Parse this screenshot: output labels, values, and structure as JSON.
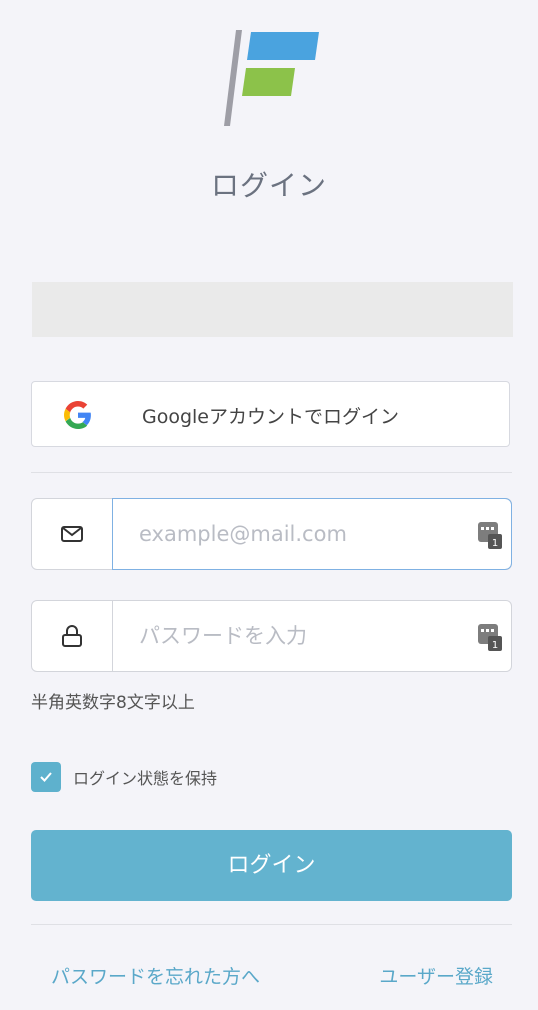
{
  "header": {
    "title": "ログイン"
  },
  "google": {
    "label": "Googleアカウントでログイン"
  },
  "email": {
    "placeholder": "example@mail.com",
    "value": ""
  },
  "password": {
    "placeholder": "パスワードを入力",
    "value": "",
    "hint": "半角英数字8文字以上"
  },
  "remember": {
    "label": "ログイン状態を保持",
    "checked": true
  },
  "login": {
    "label": "ログイン"
  },
  "links": {
    "forgot": "パスワードを忘れた方へ",
    "register": "ユーザー登録"
  },
  "colors": {
    "accent": "#63b3cf",
    "link": "#5aa8c9",
    "logo_blue": "#4aa3df",
    "logo_green": "#8cc24a"
  },
  "icons": {
    "email": "envelope-icon",
    "password": "lock-icon",
    "google": "google-g-icon",
    "password_manager": "password-manager-icon",
    "check": "checkmark-icon"
  }
}
